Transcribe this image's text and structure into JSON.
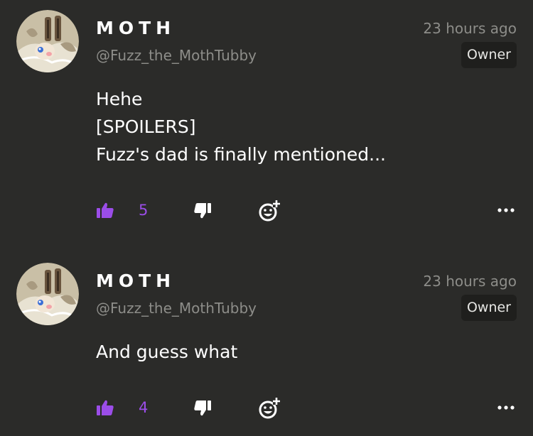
{
  "comments": [
    {
      "name": "MOTH",
      "handle": "@Fuzz_the_MothTubby",
      "time": "23 hours ago",
      "badge": "Owner",
      "lines": [
        "Hehe",
        "[SPOILERS]",
        "Fuzz's dad is finally mentioned..."
      ],
      "likes": "5"
    },
    {
      "name": "MOTH",
      "handle": "@Fuzz_the_MothTubby",
      "time": "23 hours ago",
      "badge": "Owner",
      "lines": [
        "And guess what"
      ],
      "likes": "4"
    }
  ],
  "icons": {
    "like": "thumbs-up-icon",
    "dislike": "thumbs-down-icon",
    "react": "add-reaction-icon",
    "more": "more-options-icon"
  },
  "colors": {
    "background": "#2b2b29",
    "accent": "#9b4de8",
    "muted": "#8d8d89",
    "badge_bg": "#1f1f1d"
  }
}
